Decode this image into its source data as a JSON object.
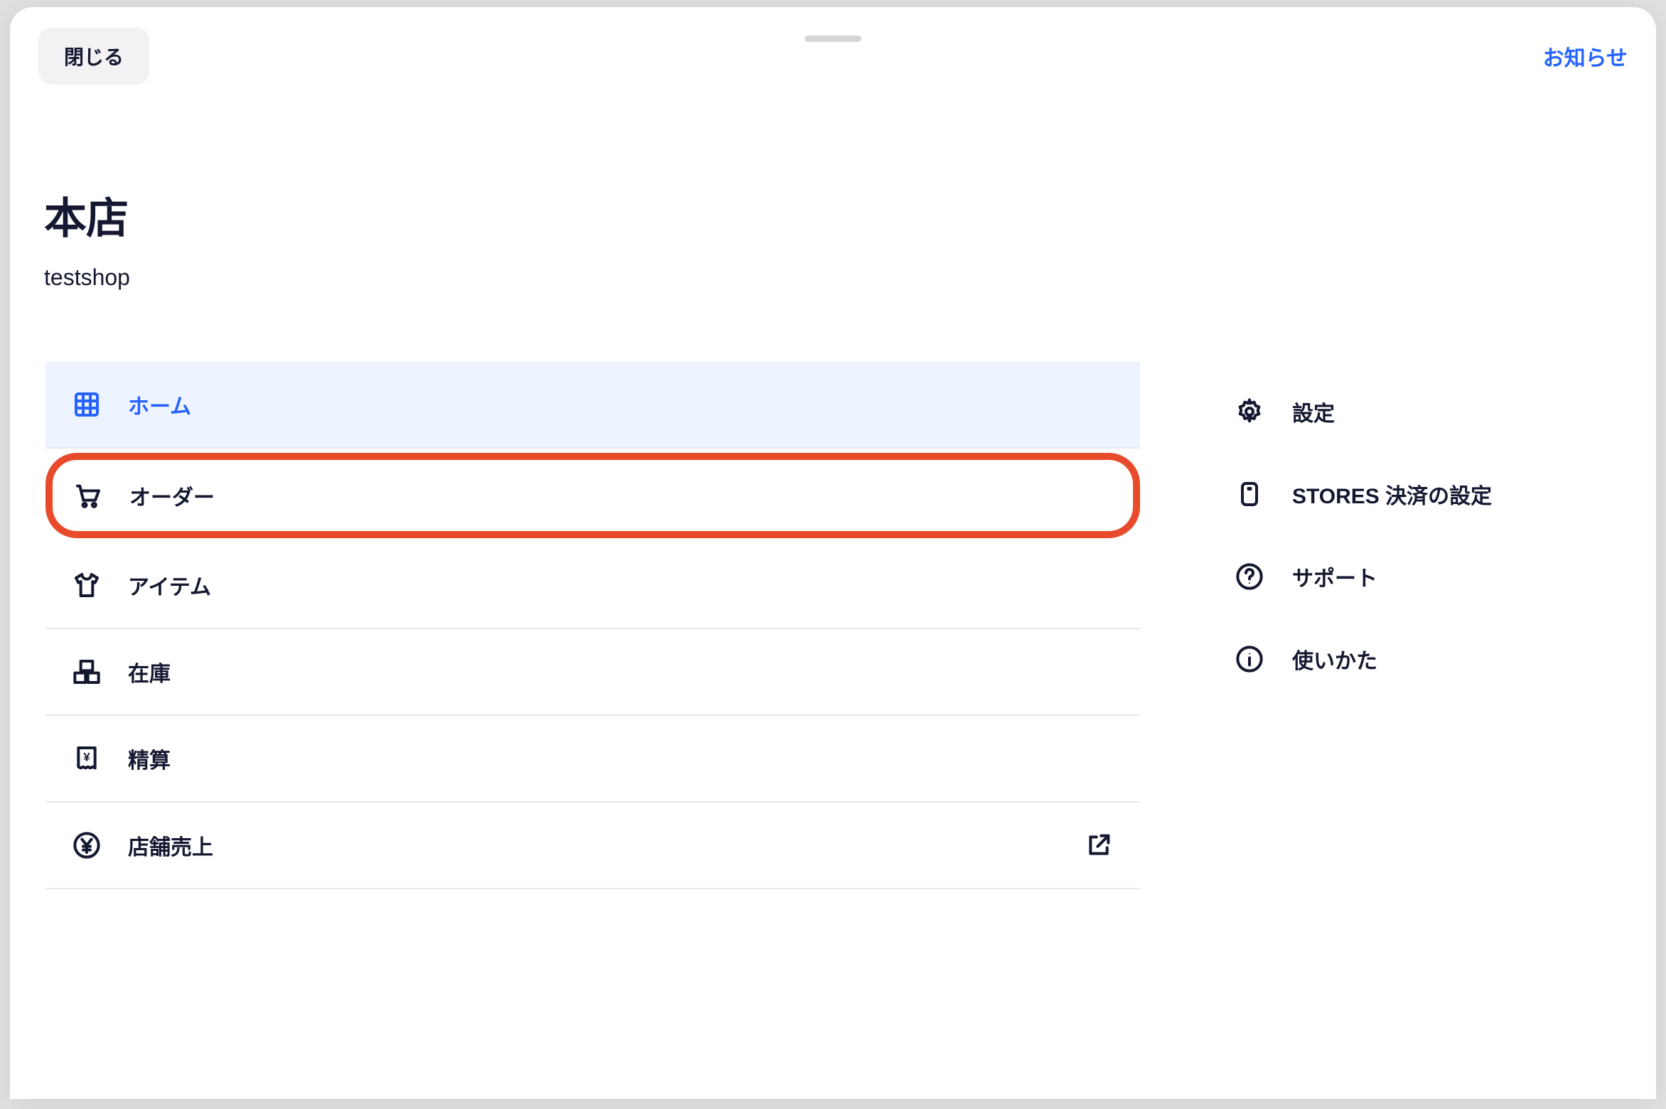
{
  "topbar": {
    "close_label": "閉じる",
    "notify_label": "お知らせ"
  },
  "store": {
    "title": "本店",
    "subtitle": "testshop"
  },
  "left_menu": [
    {
      "label": "ホーム",
      "icon": "grid-icon",
      "active": true,
      "highlight": false,
      "external": false
    },
    {
      "label": "オーダー",
      "icon": "cart-icon",
      "active": false,
      "highlight": true,
      "external": false
    },
    {
      "label": "アイテム",
      "icon": "tshirt-icon",
      "active": false,
      "highlight": false,
      "external": false
    },
    {
      "label": "在庫",
      "icon": "boxes-icon",
      "active": false,
      "highlight": false,
      "external": false
    },
    {
      "label": "精算",
      "icon": "receipt-icon",
      "active": false,
      "highlight": false,
      "external": false
    },
    {
      "label": "店舗売上",
      "icon": "yen-icon",
      "active": false,
      "highlight": false,
      "external": true
    }
  ],
  "right_menu": [
    {
      "label": "設定",
      "icon": "gear-icon"
    },
    {
      "label": "STORES 決済の設定",
      "icon": "terminal-icon"
    },
    {
      "label": "サポート",
      "icon": "help-icon"
    },
    {
      "label": "使いかた",
      "icon": "info-icon"
    }
  ]
}
